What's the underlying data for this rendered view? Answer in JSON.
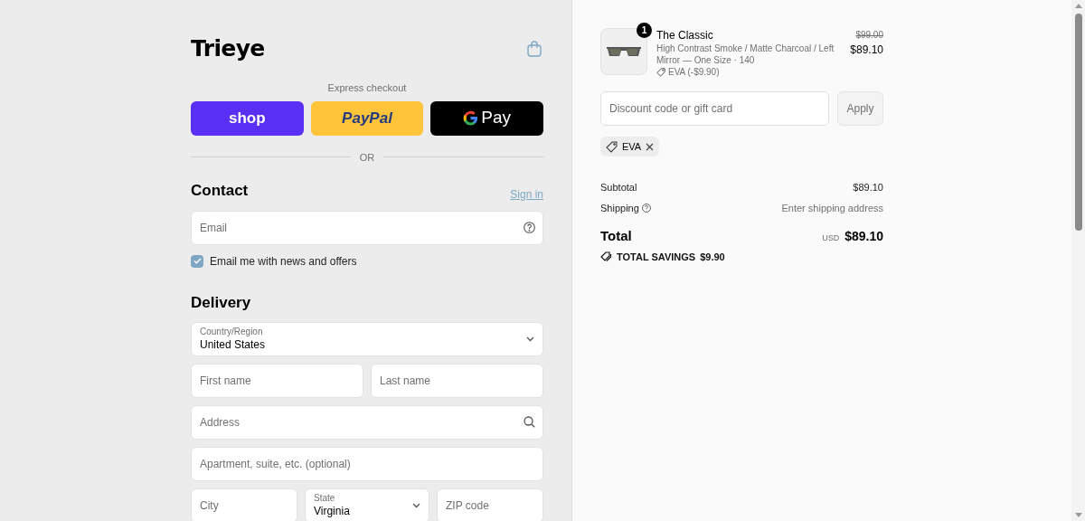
{
  "header": {
    "logo": "Trieye"
  },
  "express": {
    "title": "Express checkout",
    "buttons": [
      {
        "kind": "shop",
        "label": "shop"
      },
      {
        "kind": "paypal",
        "label": "PayPal"
      },
      {
        "kind": "gpay",
        "label": "Pay"
      }
    ],
    "divider": "OR"
  },
  "contact": {
    "title": "Contact",
    "sign_in": "Sign in",
    "email": {
      "placeholder": "Email"
    },
    "newsletter": {
      "label": "Email me with news and offers",
      "checked": true
    }
  },
  "delivery": {
    "title": "Delivery",
    "rows": [
      [
        {
          "kind": "select",
          "label": "Country/Region",
          "value": "United States"
        }
      ],
      [
        {
          "kind": "input",
          "placeholder": "First name"
        },
        {
          "kind": "input",
          "placeholder": "Last name"
        }
      ],
      [
        {
          "kind": "search",
          "placeholder": "Address"
        }
      ],
      [
        {
          "kind": "input",
          "placeholder": "Apartment, suite, etc. (optional)"
        }
      ],
      [
        {
          "kind": "input",
          "placeholder": "City"
        },
        {
          "kind": "select",
          "label": "State",
          "value": "Virginia"
        },
        {
          "kind": "input",
          "placeholder": "ZIP code"
        }
      ]
    ]
  },
  "order": {
    "item": {
      "quantity": "1",
      "name": "The Classic",
      "variant": "High Contrast Smoke / Matte Charcoal / Left Mirror — One Size · 140",
      "discount": "EVA (-$9.90)",
      "original_price": "$99.00",
      "price": "$89.10"
    },
    "discount_field": {
      "placeholder": "Discount code or gift card"
    },
    "apply": "Apply",
    "codes": [
      "EVA"
    ],
    "subtotal": {
      "label": "Subtotal",
      "value": "$89.10"
    },
    "shipping": {
      "label": "Shipping",
      "value": "Enter shipping address"
    },
    "total": {
      "label": "Total",
      "currency": "USD",
      "value": "$89.10"
    },
    "savings": {
      "label": "TOTAL SAVINGS",
      "value": "$9.90"
    }
  }
}
